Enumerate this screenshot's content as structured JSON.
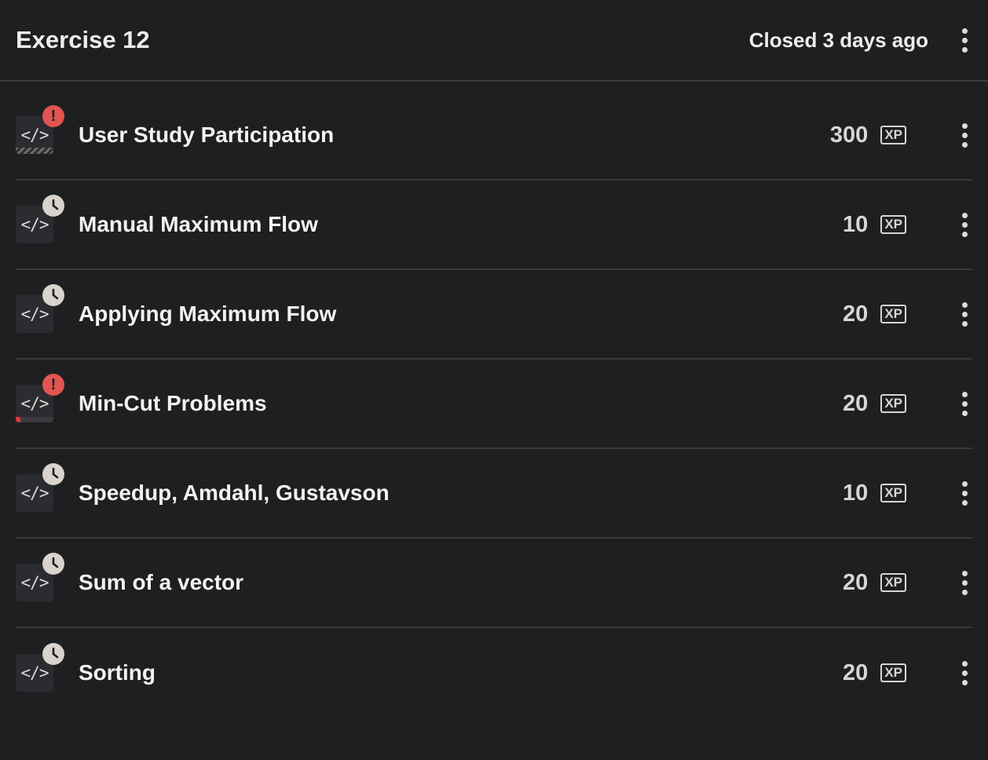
{
  "header": {
    "title": "Exercise 12",
    "status": "Closed 3 days ago"
  },
  "colors": {
    "background": "#1e1f21",
    "divider": "#3a3b3e",
    "error": "#e25553",
    "pending": "#d8d3cc"
  },
  "exercises": [
    {
      "title": "User Study Participation",
      "xp": "300",
      "xp_label": "XP",
      "status": "error",
      "status_icon": "exclamation-icon",
      "code_icon": "</>",
      "progress_style": "hatched"
    },
    {
      "title": "Manual Maximum Flow",
      "xp": "10",
      "xp_label": "XP",
      "status": "pending",
      "status_icon": "clock-icon",
      "code_icon": "</>"
    },
    {
      "title": "Applying Maximum Flow",
      "xp": "20",
      "xp_label": "XP",
      "status": "pending",
      "status_icon": "clock-icon",
      "code_icon": "</>"
    },
    {
      "title": "Min-Cut Problems",
      "xp": "20",
      "xp_label": "XP",
      "status": "error",
      "status_icon": "exclamation-icon",
      "code_icon": "</>",
      "progress": 0.12
    },
    {
      "title": "Speedup, Amdahl, Gustavson",
      "xp": "10",
      "xp_label": "XP",
      "status": "pending",
      "status_icon": "clock-icon",
      "code_icon": "</>"
    },
    {
      "title": "Sum of a vector",
      "xp": "20",
      "xp_label": "XP",
      "status": "pending",
      "status_icon": "clock-icon",
      "code_icon": "</>"
    },
    {
      "title": "Sorting",
      "xp": "20",
      "xp_label": "XP",
      "status": "pending",
      "status_icon": "clock-icon",
      "code_icon": "</>"
    }
  ]
}
